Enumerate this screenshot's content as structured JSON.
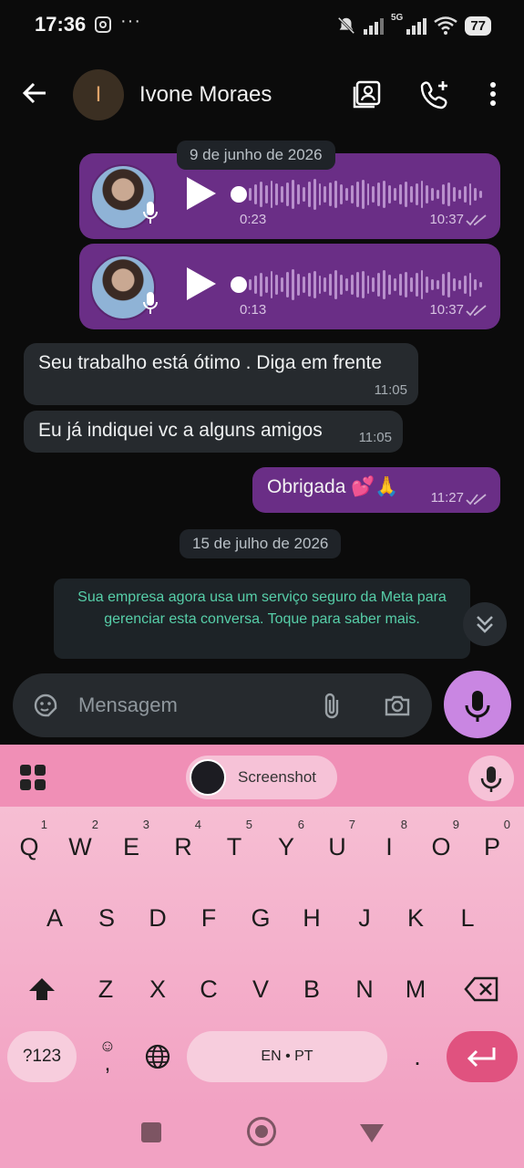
{
  "status_bar": {
    "time": "17:36",
    "network": "5G",
    "battery": "77"
  },
  "header": {
    "avatar_initial": "I",
    "contact_name": "Ivone Moraes"
  },
  "chat": {
    "date_1": "9 de junho de 2026",
    "voice_messages": [
      {
        "duration": "0:23",
        "time": "10:37"
      },
      {
        "duration": "0:13",
        "time": "10:37"
      }
    ],
    "incoming": [
      {
        "text": "Seu trabalho está ótimo . Diga em frente",
        "time": "11:05"
      },
      {
        "text": "Eu já indiquei vc a alguns amigos",
        "time": "11:05"
      }
    ],
    "outgoing": {
      "text": "Obrigada 💕🙏",
      "time": "11:27"
    },
    "date_2": "15 de julho de 2026",
    "system_message": "Sua empresa agora usa um serviço seguro da Meta para gerenciar esta conversa. Toque para saber mais."
  },
  "input": {
    "placeholder": "Mensagem"
  },
  "keyboard": {
    "suggestion_chip": "Screenshot",
    "row1": [
      "Q",
      "W",
      "E",
      "R",
      "T",
      "Y",
      "U",
      "I",
      "O",
      "P"
    ],
    "row1_hints": [
      "1",
      "2",
      "3",
      "4",
      "5",
      "6",
      "7",
      "8",
      "9",
      "0"
    ],
    "row2": [
      "A",
      "S",
      "D",
      "F",
      "G",
      "H",
      "J",
      "K",
      "L"
    ],
    "row3": [
      "Z",
      "X",
      "C",
      "V",
      "B",
      "N",
      "M"
    ],
    "symbols_key": "?123",
    "comma_key": ",",
    "space_label": "EN • PT",
    "period_key": "."
  },
  "colors": {
    "accent": "#6a2e86",
    "mic_button": "#c986e2",
    "keyboard_bg": "#f3a9c6",
    "system_text": "#57cfa9"
  }
}
